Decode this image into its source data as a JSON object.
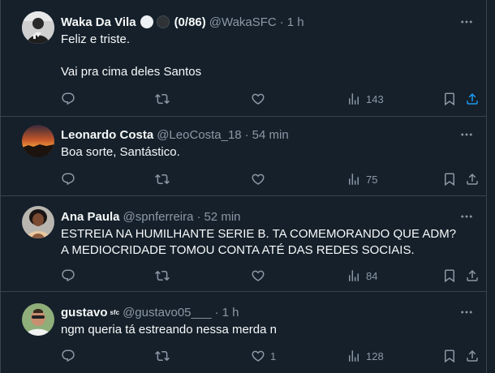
{
  "colors": {
    "background": "#15202b",
    "border": "#38444d",
    "text_primary": "#f7f9f9",
    "text_secondary": "#8b98a5",
    "share_active": "#1d9bf0"
  },
  "tweets": [
    {
      "name": "Waka Da Vila",
      "name_suffix": "(0/86)",
      "handle": "@WakaSFC",
      "time": "1 h",
      "text": "Feliz e triste.\n\nVai pra cima deles Santos",
      "views": "143",
      "likes": ""
    },
    {
      "name": "Leonardo Costa",
      "handle": "@LeoCosta_18",
      "time": "54 min",
      "text": "Boa sorte, Santástico.",
      "views": "75",
      "likes": ""
    },
    {
      "name": "Ana Paula",
      "handle": "@spnferreira",
      "time": "52 min",
      "text": "ESTREIA NA HUMILHANTE SERIE B. TA COMEMORANDO QUE ADM? A MEDIOCRIDADE TOMOU CONTA ATÉ DAS REDES SOCIAIS.",
      "views": "84",
      "likes": ""
    },
    {
      "name": "gustavo",
      "name_sup": "sfc",
      "handle": "@gustavo05___",
      "time": "1 h",
      "text": "ngm queria tá estreando nessa merda n",
      "views": "128",
      "likes": "1"
    }
  ],
  "separator": "·",
  "icons": {
    "more": "more-dots-icon",
    "reply": "reply-icon",
    "retweet": "retweet-icon",
    "like": "heart-icon",
    "views": "views-chart-icon",
    "bookmark": "bookmark-icon",
    "share": "share-icon"
  }
}
